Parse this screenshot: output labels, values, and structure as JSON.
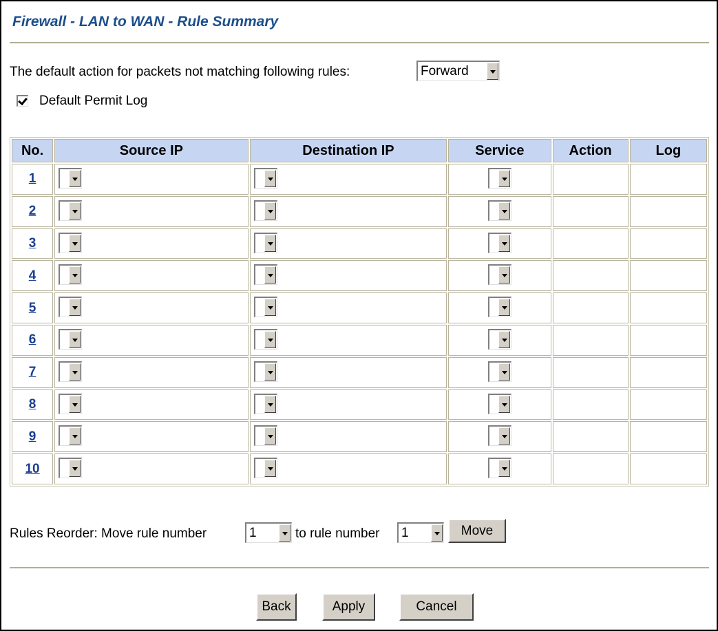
{
  "page": {
    "title": "Firewall - LAN to WAN - Rule Summary"
  },
  "default_action": {
    "label": "The default action for packets not matching following rules:",
    "value": "Forward"
  },
  "default_permit_log": {
    "label": "Default Permit Log",
    "checked": true
  },
  "table": {
    "headers": {
      "no": "No.",
      "source_ip": "Source IP",
      "destination_ip": "Destination IP",
      "service": "Service",
      "action": "Action",
      "log": "Log"
    },
    "rows": [
      {
        "no": "1"
      },
      {
        "no": "2"
      },
      {
        "no": "3"
      },
      {
        "no": "4"
      },
      {
        "no": "5"
      },
      {
        "no": "6"
      },
      {
        "no": "7"
      },
      {
        "no": "8"
      },
      {
        "no": "9"
      },
      {
        "no": "10"
      }
    ]
  },
  "reorder": {
    "label_prefix": "Rules Reorder: Move rule number",
    "from_value": "1",
    "label_mid": "to rule number",
    "to_value": "1",
    "move_label": "Move"
  },
  "buttons": {
    "back": "Back",
    "apply": "Apply",
    "cancel": "Cancel"
  },
  "colors": {
    "title": "#1c4f8c",
    "header_bg": "#c6d6f2",
    "link": "#1b3f8f",
    "divider": "#b3ae95"
  }
}
